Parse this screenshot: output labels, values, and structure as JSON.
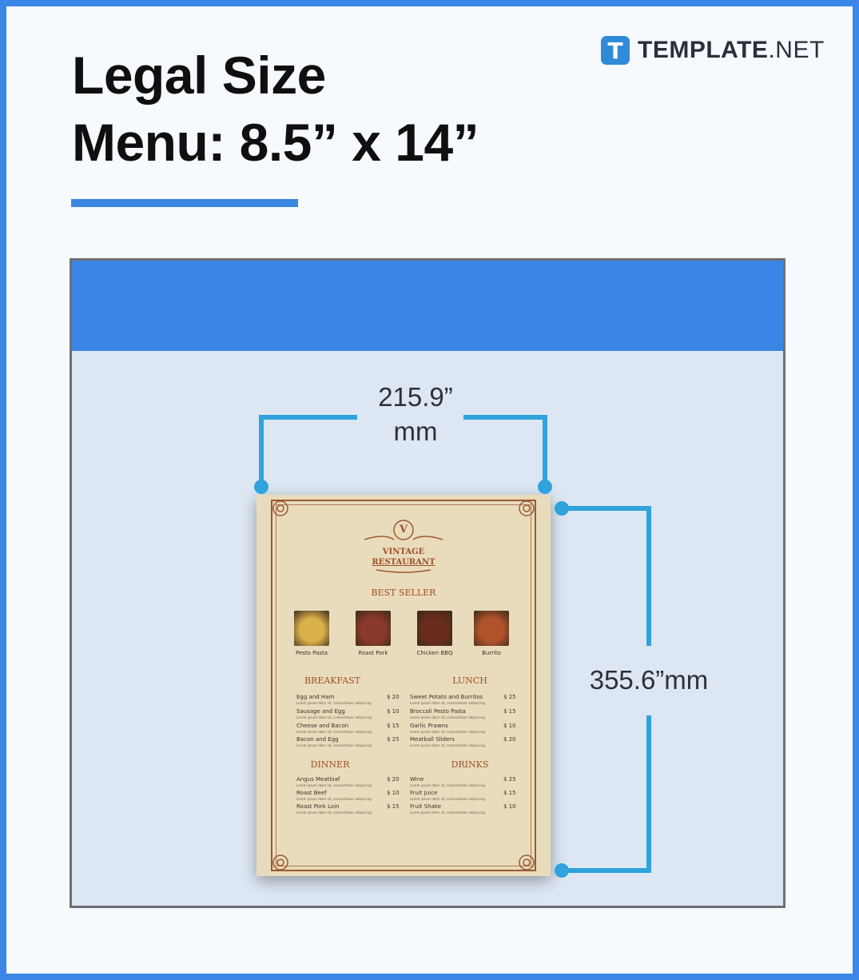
{
  "header": {
    "title_line1": "Legal Size",
    "title_line2": "Menu: 8.5” x 14”"
  },
  "logo": {
    "badge": "T",
    "brand_bold": "TEMPLATE",
    "brand_suffix": ".NET",
    "icon": "template-logo-icon"
  },
  "dimensions": {
    "width_value": "215.9”",
    "width_unit": "mm",
    "height_label": "355.6”mm"
  },
  "menu_sample": {
    "monogram": "V",
    "restaurant_line1": "VINTAGE",
    "restaurant_line2": "RESTAURANT",
    "best_seller_heading": "BEST SELLER",
    "best_sellers": [
      {
        "name": "Pesto Pasta",
        "color": "#d9b04a"
      },
      {
        "name": "Roast Pork",
        "color": "#8a3a2a"
      },
      {
        "name": "Chicken BBQ",
        "color": "#6a2c1e"
      },
      {
        "name": "Burrito",
        "color": "#b0532c"
      }
    ],
    "sections": [
      {
        "heading": "BREAKFAST",
        "items": [
          {
            "name": "Egg and Ham",
            "price": "$ 20"
          },
          {
            "name": "Sausage and Egg",
            "price": "$ 10"
          },
          {
            "name": "Cheese and Bacon",
            "price": "$ 15"
          },
          {
            "name": "Bacon and Egg",
            "price": "$ 25"
          }
        ]
      },
      {
        "heading": "LUNCH",
        "items": [
          {
            "name": "Sweet Potato and Burritos",
            "price": "$ 25"
          },
          {
            "name": "Broccoli Pesto Pasta",
            "price": "$ 15"
          },
          {
            "name": "Garlic Prawns",
            "price": "$ 10"
          },
          {
            "name": "Meatball Sliders",
            "price": "$ 20"
          }
        ]
      },
      {
        "heading": "DINNER",
        "items": [
          {
            "name": "Angus Meatloaf",
            "price": "$ 20"
          },
          {
            "name": "Roast Beef",
            "price": "$ 10"
          },
          {
            "name": "Roast Pork Loin",
            "price": "$ 15"
          }
        ]
      },
      {
        "heading": "DRINKS",
        "items": [
          {
            "name": "Wine",
            "price": "$ 25"
          },
          {
            "name": "Fruit Juice",
            "price": "$ 15"
          },
          {
            "name": "Fruit Shake",
            "price": "$ 10"
          }
        ]
      }
    ],
    "item_description": "Lorem ipsum dolor sit, consectetuer adipiscing."
  },
  "colors": {
    "accent_blue": "#3a86e6",
    "dimension_line": "#2ea3dc",
    "menu_paper": "#e9dcbd",
    "menu_ink": "#9e4f27"
  }
}
